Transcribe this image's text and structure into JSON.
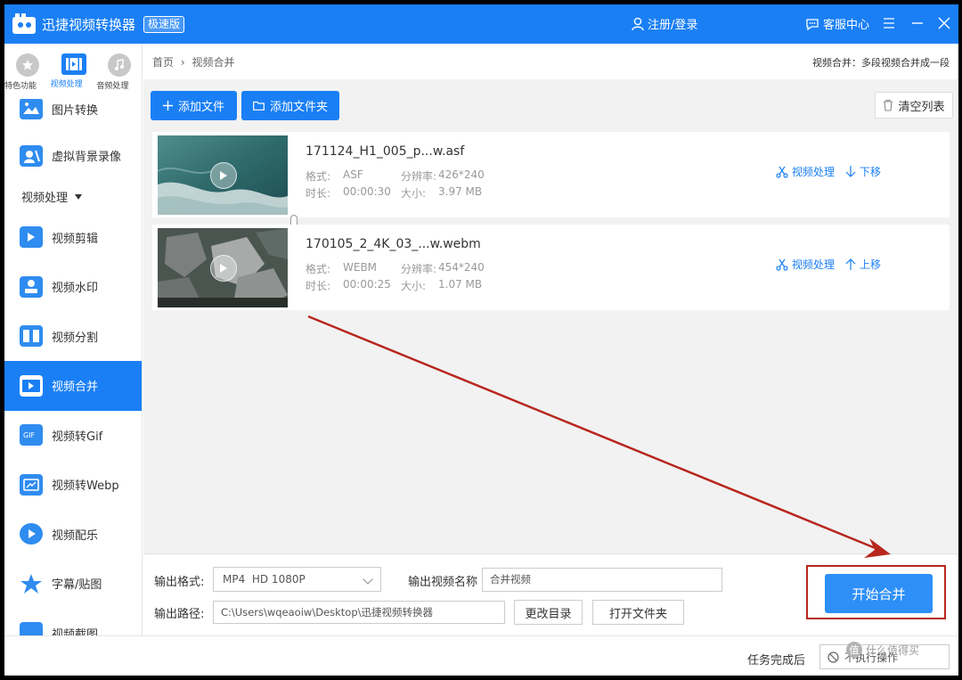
{
  "titlebar": {
    "app_title": "迅捷视频转换器",
    "edition": "极速版",
    "login": "注册/登录",
    "service": "客服中心",
    "menu_icon": "hamburger-icon",
    "minimize_icon": "minimize-icon",
    "close_icon": "close-icon"
  },
  "sidebar": {
    "tabs": [
      {
        "label": "特色功能",
        "icon": "star-icon"
      },
      {
        "label": "视频处理",
        "icon": "film-icon"
      },
      {
        "label": "音频处理",
        "icon": "music-icon"
      }
    ],
    "items_top": [
      {
        "label": "图片转换",
        "icon": "image-convert-icon"
      },
      {
        "label": "虚拟背景录像",
        "icon": "virtual-background-icon"
      }
    ],
    "section": "视频处理",
    "items": [
      {
        "label": "视频剪辑",
        "icon": "video-edit-icon"
      },
      {
        "label": "视频水印",
        "icon": "watermark-icon"
      },
      {
        "label": "视频分割",
        "icon": "video-split-icon"
      },
      {
        "label": "视频合并",
        "icon": "video-merge-icon"
      },
      {
        "label": "视频转Gif",
        "icon": "gif-icon"
      },
      {
        "label": "视频转Webp",
        "icon": "webp-icon"
      },
      {
        "label": "视频配乐",
        "icon": "music-note-icon"
      },
      {
        "label": "字幕/贴图",
        "icon": "subtitle-sticker-icon"
      },
      {
        "label": "视频截图",
        "icon": "screenshot-icon"
      }
    ],
    "active_item": "视频合并"
  },
  "main": {
    "breadcrumb": {
      "home": "首页",
      "separator": "›",
      "current": "视频合并"
    },
    "merge_note": "视频合并：多段视频合并成一段",
    "add_file": "添加文件",
    "add_folder": "添加文件夹",
    "clear_list": "清空列表",
    "files": [
      {
        "name": "171124_H1_005_p...w.asf",
        "format_label": "格式:",
        "format": "ASF",
        "resolution_label": "分辨率:",
        "resolution": "426*240",
        "duration_label": "时长:",
        "duration": "00:00:30",
        "size_label": "大小:",
        "size": "3.97 MB",
        "process": "视频处理",
        "move": "下移",
        "move_icon": "arrow-down-icon"
      },
      {
        "name": "170105_2_4K_03_...w.webm",
        "format_label": "格式:",
        "format": "WEBM",
        "resolution_label": "分辨率:",
        "resolution": "454*240",
        "duration_label": "时长:",
        "duration": "00:00:25",
        "size_label": "大小:",
        "size": "1.07 MB",
        "process": "视频处理",
        "move": "上移",
        "move_icon": "arrow-up-icon"
      }
    ]
  },
  "output": {
    "format_label": "输出格式:",
    "format_value": "MP4  HD 1080P",
    "name_label": "输出视频名称",
    "name_value": "合并视频",
    "path_label": "输出路径:",
    "path_value": "C:\\Users\\wqeaoiw\\Desktop\\迅捷视频转换器",
    "change_dir": "更改目录",
    "open_folder": "打开文件夹",
    "start": "开始合并"
  },
  "status": {
    "after_task_label": "任务完成后",
    "after_task_value": "不执行操作"
  },
  "watermark": {
    "badge": "值",
    "text": "什么值得买"
  },
  "colors": {
    "brand": "#1a7ff5",
    "annotation_red": "#b8271e"
  }
}
